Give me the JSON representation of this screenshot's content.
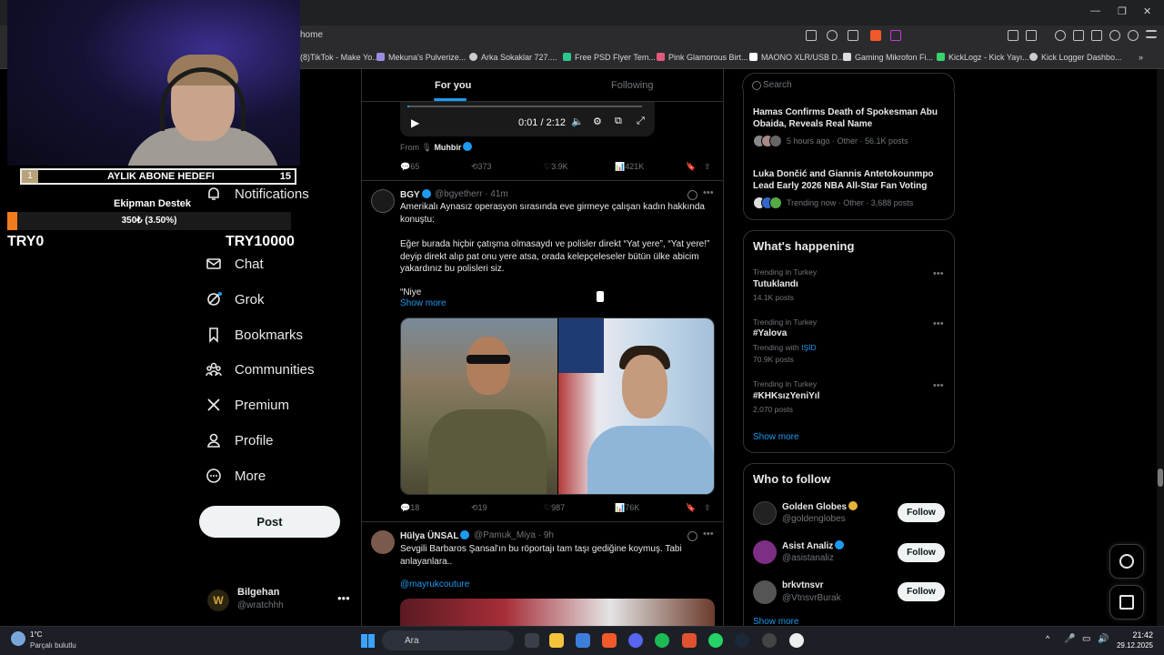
{
  "browser": {
    "address": "home",
    "bookmarks": [
      "(8)TikTok - Make Yo...",
      "Mekuna's Pulverize...",
      "Arka Sokaklar 727....",
      "Free PSD Flyer Tem...",
      "Pink Glamorous Birt...",
      "MAONO XLR/USB D...",
      "Gaming Mikrofon Fi...",
      "KickLogz - Kick Yayı...",
      "Kick Logger Dashbo..."
    ]
  },
  "overlay": {
    "goal_number": "1",
    "goal_title": "AYLIK ABONE HEDEFI",
    "goal_count": "15",
    "equipment_title": "Ekipman Destek",
    "equipment_progress": "350₺ (3.50%)",
    "equipment_fraction": 0.035,
    "min_label": "TRY0",
    "max_label": "TRY10000"
  },
  "nav": {
    "items": [
      {
        "label": "Notifications",
        "icon": "bell-icon"
      },
      {
        "label": "Chat",
        "icon": "mail-icon"
      },
      {
        "label": "Grok",
        "icon": "grok-icon"
      },
      {
        "label": "Bookmarks",
        "icon": "bookmark-icon"
      },
      {
        "label": "Communities",
        "icon": "people-icon"
      },
      {
        "label": "Premium",
        "icon": "x-icon"
      },
      {
        "label": "Profile",
        "icon": "person-icon"
      },
      {
        "label": "More",
        "icon": "more-circle-icon"
      }
    ],
    "post_label": "Post",
    "account_name": "Bilgehan",
    "account_handle": "@wratchhh"
  },
  "feed": {
    "tab_for_you": "For you",
    "tab_following": "Following",
    "video_time": "0:01 / 2:12",
    "from_label": "From",
    "from_name": "Muhbir",
    "tweet0_stats": {
      "replies": "65",
      "reposts": "373",
      "likes": "3.9K",
      "views": "421K"
    },
    "tweet1": {
      "name": "BGY",
      "handle": "@bgyetherr · 41m",
      "text1": "Amerikalı Aynasız operasyon sırasında eve girmeye çalışan kadın hakkında konuştu:",
      "text2": "Eğer burada hiçbir çatışma olmasaydı ve polisler direkt “Yat yere”, “Yat yere!” deyip direkt alıp pat onu yere atsa, orada kelepçeleseler bütün ülke abicim yakardınız bu polisleri siz.",
      "text3": "“Niye",
      "show_more": "Show more",
      "stats": {
        "replies": "18",
        "reposts": "19",
        "likes": "987",
        "views": "76K"
      }
    },
    "tweet2": {
      "name": "Hülya ÜNSAL",
      "handle": "@Pamuk_Miya · 9h",
      "text": "Sevgili Barbaros Şansal'ın bu röportajı tam taşı gediğine koymuş. Tabi anlayanlara..",
      "mention": "@mayrukcouture"
    }
  },
  "sidebar": {
    "search_placeholder": "Search",
    "news": [
      {
        "title": "Hamas Confirms Death of Spokesman Abu Obaida, Reveals Real Name",
        "meta": "5 hours ago · Other · 56.1K posts"
      },
      {
        "title": "Luka Dončić and Giannis Antetokounmpo Lead Early 2026 NBA All-Star Fan Voting",
        "meta": "Trending now · Other · 3,688 posts"
      }
    ],
    "whats_happening": "What's happening",
    "trends": [
      {
        "context": "Trending in Turkey",
        "name": "Tutuklandı",
        "posts": "14.1K posts",
        "with": ""
      },
      {
        "context": "Trending in Turkey",
        "name": "#Yalova",
        "posts": "70.9K posts",
        "with": "Trending with",
        "with_link": "IŞİD"
      },
      {
        "context": "Trending in Turkey",
        "name": "#KHKsızYeniYıl",
        "posts": "2,070 posts",
        "with": ""
      }
    ],
    "show_more": "Show more",
    "who_to_follow": "Who to follow",
    "follow_label": "Follow",
    "suggestions": [
      {
        "name": "Golden Globes",
        "handle": "@goldenglobes"
      },
      {
        "name": "Asist Analiz",
        "handle": "@asistanaliz"
      },
      {
        "name": "brkvtnsvr",
        "handle": "@VtnsvrBurak"
      }
    ],
    "show_more_bottom": "Show more"
  },
  "taskbar": {
    "weather_temp": "1°C",
    "weather_desc": "Parçalı bulutlu",
    "search": "Ara",
    "time": "21:42",
    "date": "29.12.2025"
  },
  "colors": {
    "accent": "#1d9bf0",
    "background": "#000000",
    "equipment_fill": "#f07b1c"
  }
}
